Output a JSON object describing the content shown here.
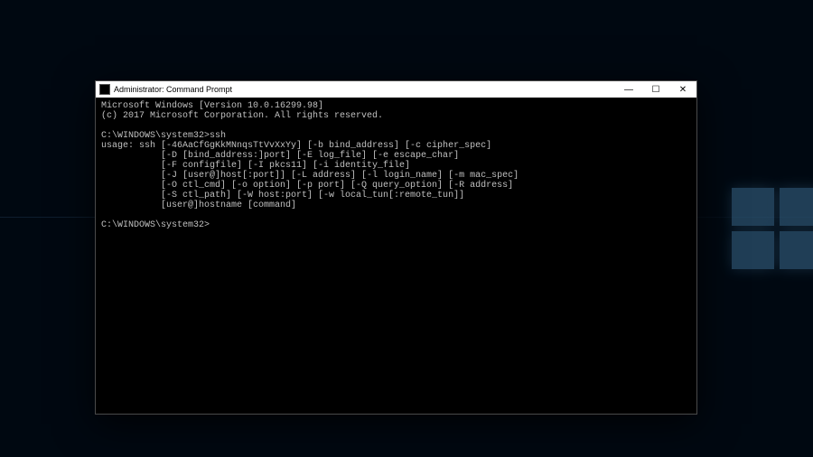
{
  "titlebar": {
    "title": "Administrator: Command Prompt"
  },
  "window_controls": {
    "minimize": "—",
    "maximize": "☐",
    "close": "✕"
  },
  "terminal": {
    "line_version": "Microsoft Windows [Version 10.0.16299.98]",
    "line_copyright": "(c) 2017 Microsoft Corporation. All rights reserved.",
    "blank1": "",
    "prompt1": "C:\\WINDOWS\\system32>ssh",
    "usage1": "usage: ssh [-46AaCfGgKkMNnqsTtVvXxYy] [-b bind_address] [-c cipher_spec]",
    "usage2": "           [-D [bind_address:]port] [-E log_file] [-e escape_char]",
    "usage3": "           [-F configfile] [-I pkcs11] [-i identity_file]",
    "usage4": "           [-J [user@]host[:port]] [-L address] [-l login_name] [-m mac_spec]",
    "usage5": "           [-O ctl_cmd] [-o option] [-p port] [-Q query_option] [-R address]",
    "usage6": "           [-S ctl_path] [-W host:port] [-w local_tun[:remote_tun]]",
    "usage7": "           [user@]hostname [command]",
    "blank2": "",
    "prompt2": "C:\\WINDOWS\\system32>"
  }
}
